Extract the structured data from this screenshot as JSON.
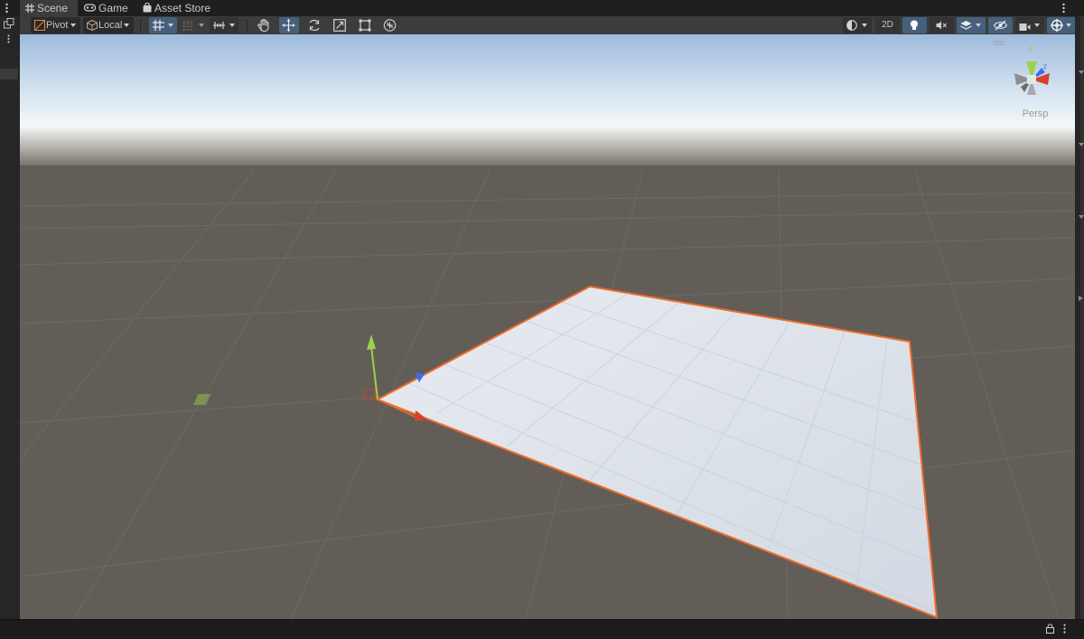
{
  "tabs": [
    {
      "label": "Scene",
      "icon": "grid-icon",
      "active": true
    },
    {
      "label": "Game",
      "icon": "gamepad-icon",
      "active": false
    },
    {
      "label": "Asset Store",
      "icon": "shopping-bag-icon",
      "active": false
    }
  ],
  "toolbar": {
    "pivot_label": "Pivot",
    "local_label": "Local",
    "twod_label": "2D"
  },
  "gizmo": {
    "projection_label": "Persp",
    "y_axis": "y",
    "x_axis": "x",
    "z_axis": "z"
  },
  "colors": {
    "selection_outline": "#f26b2a",
    "axis_x": "#d5412b",
    "axis_y": "#9bd24a",
    "axis_z": "#3b6ee8",
    "plane": "#dde3ea",
    "ground": "#635d57",
    "toggle_on": "#46607c"
  }
}
